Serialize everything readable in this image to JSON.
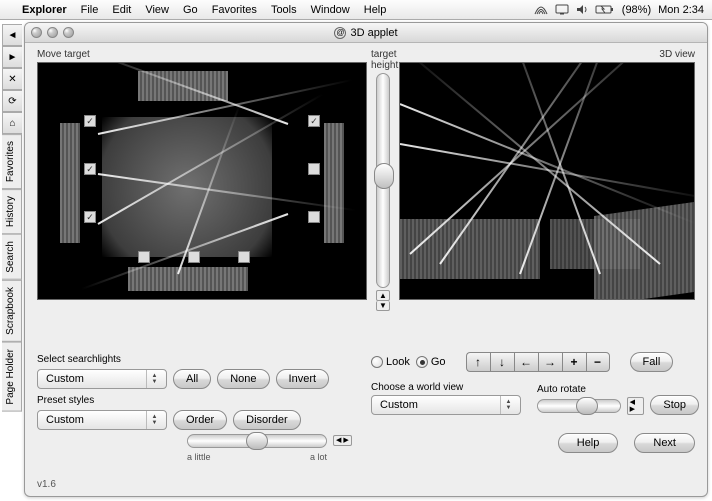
{
  "menubar": {
    "app": "Explorer",
    "items": [
      "File",
      "Edit",
      "View",
      "Go",
      "Favorites",
      "Tools",
      "Window",
      "Help"
    ],
    "battery": "(98%)",
    "clock": "Mon 2:34"
  },
  "window": {
    "title": "3D applet"
  },
  "sidebar": {
    "tabs": [
      "Favorites",
      "History",
      "Search",
      "Scrapbook",
      "Page Holder"
    ]
  },
  "left": {
    "viewport_label": "Move target",
    "select_label": "Select searchlights",
    "select_value": "Custom",
    "btn_all": "All",
    "btn_none": "None",
    "btn_invert": "Invert",
    "preset_label": "Preset styles",
    "preset_value": "Custom",
    "btn_order": "Order",
    "btn_disorder": "Disorder",
    "slider_min": "a little",
    "slider_max": "a lot"
  },
  "center": {
    "label": "target height"
  },
  "right": {
    "viewport_label": "3D view",
    "radio_look": "Look",
    "radio_go": "Go",
    "nav_arrows": [
      "↑",
      "↓",
      "←",
      "→",
      "+",
      "−"
    ],
    "btn_fall": "Fall",
    "world_label": "Choose a world view",
    "world_value": "Custom",
    "autorotate_label": "Auto rotate",
    "btn_stop": "Stop",
    "btn_help": "Help",
    "btn_next": "Next"
  },
  "version": "v1.6"
}
